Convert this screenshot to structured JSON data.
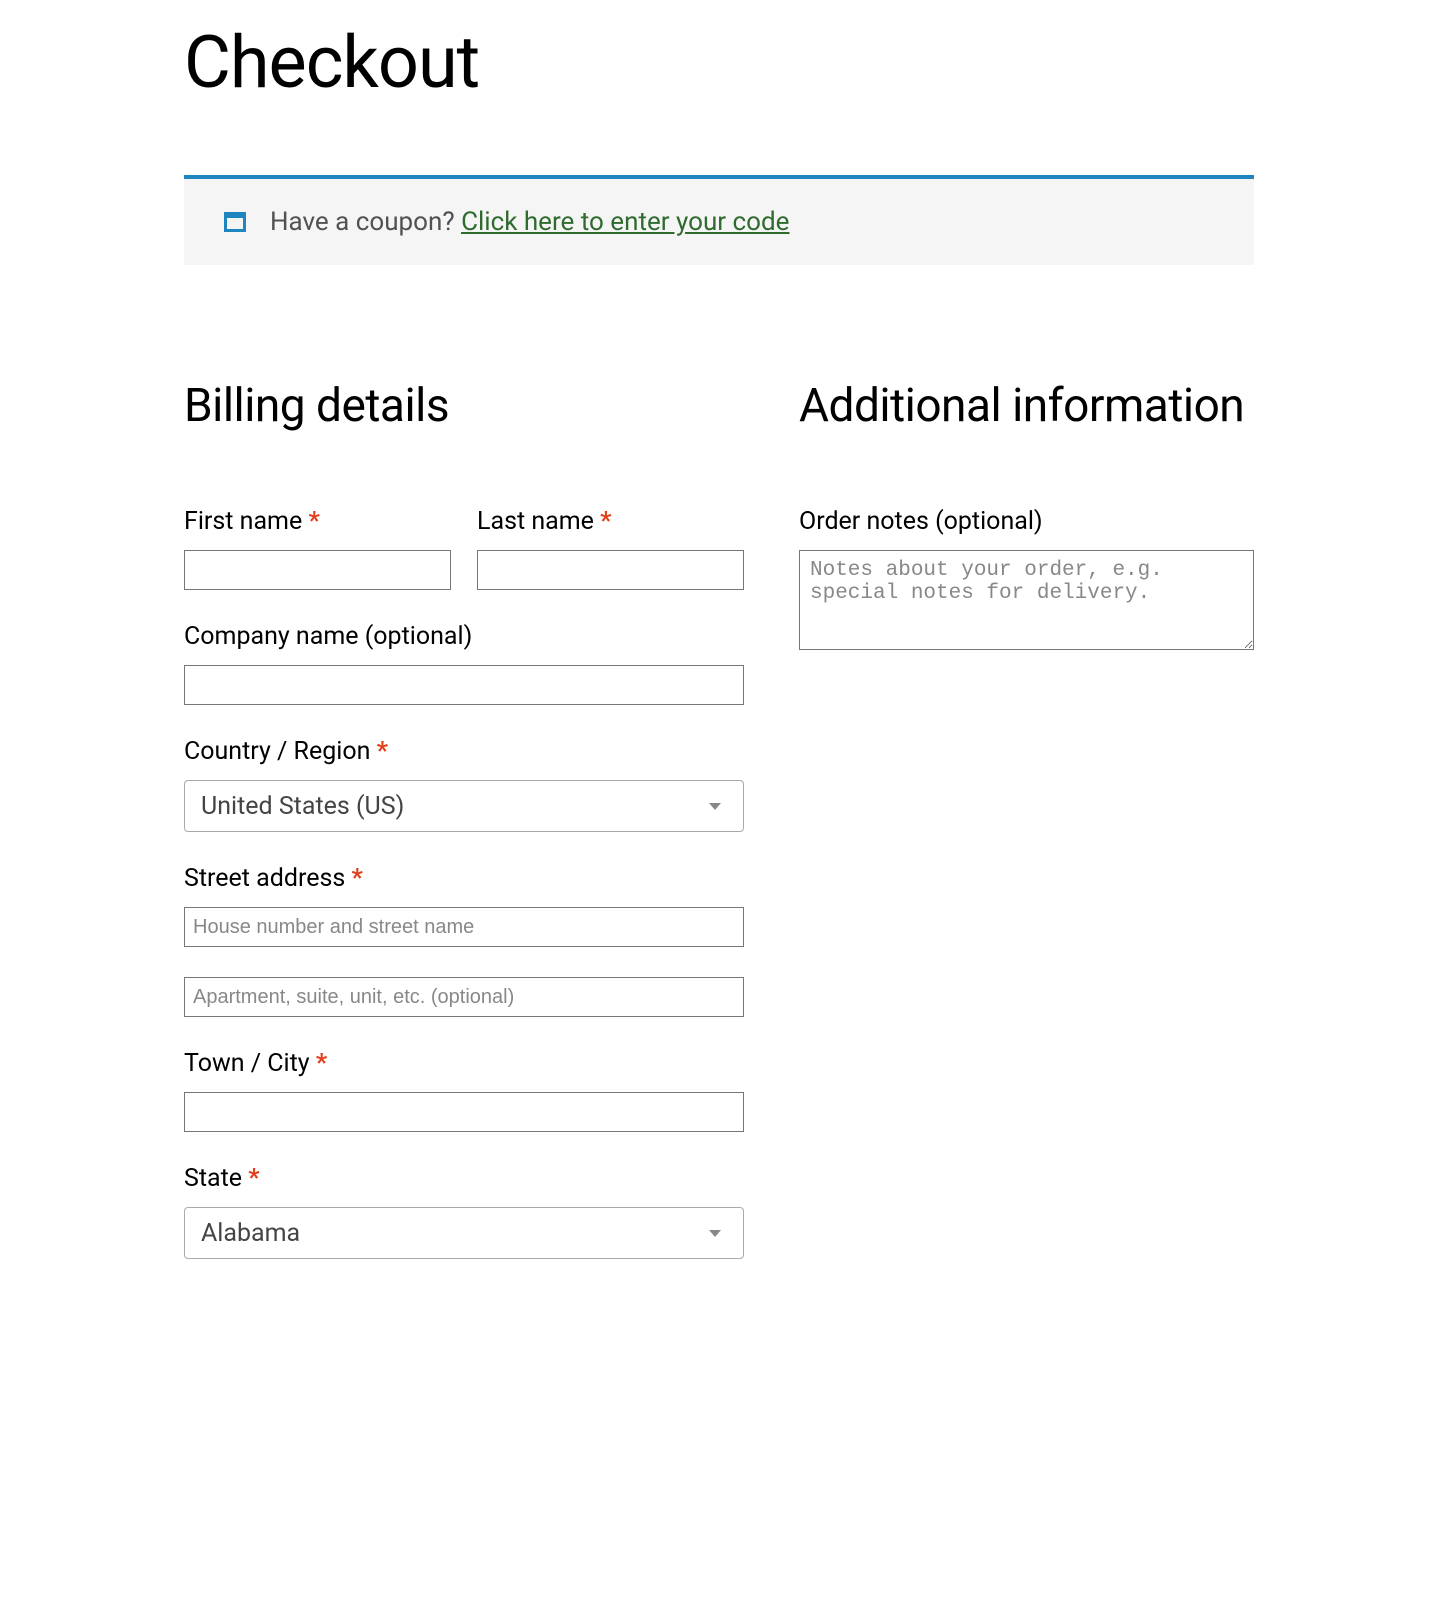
{
  "page": {
    "title": "Checkout"
  },
  "coupon": {
    "prompt": "Have a coupon? ",
    "link_text": "Click here to enter your code"
  },
  "billing": {
    "heading": "Billing details",
    "first_name_label": "First name ",
    "last_name_label": "Last name ",
    "company_label": "Company name (optional)",
    "country_label": "Country / Region ",
    "country_value": "United States (US)",
    "street_label": "Street address ",
    "street_placeholder": "House number and street name",
    "street2_placeholder": "Apartment, suite, unit, etc. (optional)",
    "city_label": "Town / City ",
    "state_label": "State ",
    "state_value": "Alabama",
    "required_mark": "*"
  },
  "additional": {
    "heading": "Additional information",
    "order_notes_label": "Order notes (optional)",
    "order_notes_placeholder": "Notes about your order, e.g. special notes for delivery."
  }
}
